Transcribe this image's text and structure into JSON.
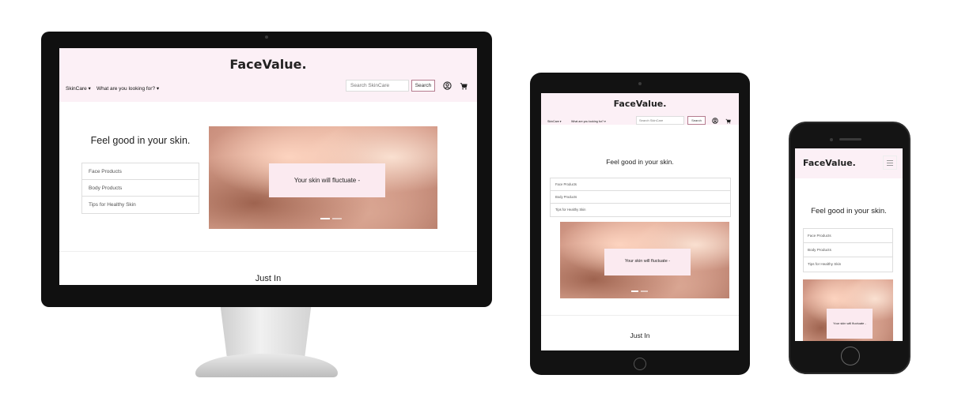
{
  "site": {
    "brand": "FaceValue.",
    "nav": {
      "dropdown_1": "SkinCare",
      "dropdown_2": "What are you looking for?",
      "search_placeholder": "Search SkinCare",
      "search_button": "Search"
    },
    "tagline": "Feel good in your skin.",
    "categories": [
      "Face Products",
      "Body Products",
      "Tips for Healthy Skin"
    ],
    "hero_caption": "Your skin will fluctuate -",
    "section_heading": "Just In"
  },
  "colors": {
    "nav_background": "#fcf0f6",
    "button_border": "#b47c8f",
    "device_frame": "#101010"
  },
  "icons": {
    "account": "user-circle-icon",
    "cart": "shopping-cart-icon",
    "menu": "hamburger-menu-icon",
    "dropdown": "caret-down-icon"
  }
}
